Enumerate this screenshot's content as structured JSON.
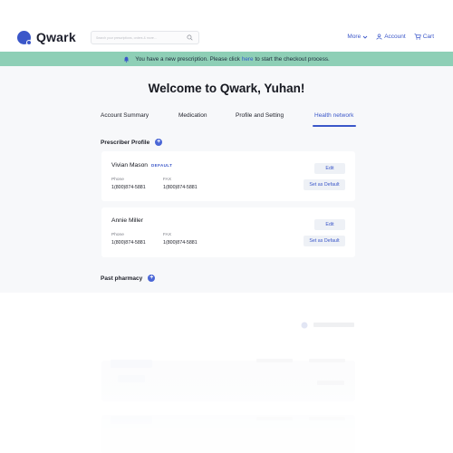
{
  "app": {
    "name": "Qwark"
  },
  "search": {
    "placeholder": "Search your prescriptions, orders & more..."
  },
  "nav": {
    "more": "More",
    "account": "Account",
    "cart": "Cart"
  },
  "banner": {
    "prefix": "You have a new prescription. Please click",
    "link": "here",
    "suffix": "to start the checkout process."
  },
  "welcome": "Welcome to Qwark, Yuhan!",
  "tabs": [
    {
      "label": "Account Summary"
    },
    {
      "label": "Medication"
    },
    {
      "label": "Profile and Setting"
    },
    {
      "label": "Health network"
    }
  ],
  "prescriber_section": {
    "title": "Prescriber Profile"
  },
  "prescribers": [
    {
      "name": "Vivian Mason",
      "badge": "DEFAULT",
      "phone_label": "Phone",
      "phone": "1(800)874-5881",
      "fax_label": "FAX",
      "fax": "1(800)874-5881",
      "edit_label": "Edit",
      "default_label": "Set as Default"
    },
    {
      "name": "Annie Miller",
      "badge": "",
      "phone_label": "Phone",
      "phone": "1(800)874-5881",
      "fax_label": "FAX",
      "fax": "1(800)874-5881",
      "edit_label": "Edit",
      "default_label": "Set as Default"
    }
  ],
  "pharmacy_section": {
    "title": "Past pharmacy"
  },
  "colors": {
    "brand": "#3b57c9",
    "banner": "#8ecfb6",
    "panel": "#f7f8fa"
  }
}
